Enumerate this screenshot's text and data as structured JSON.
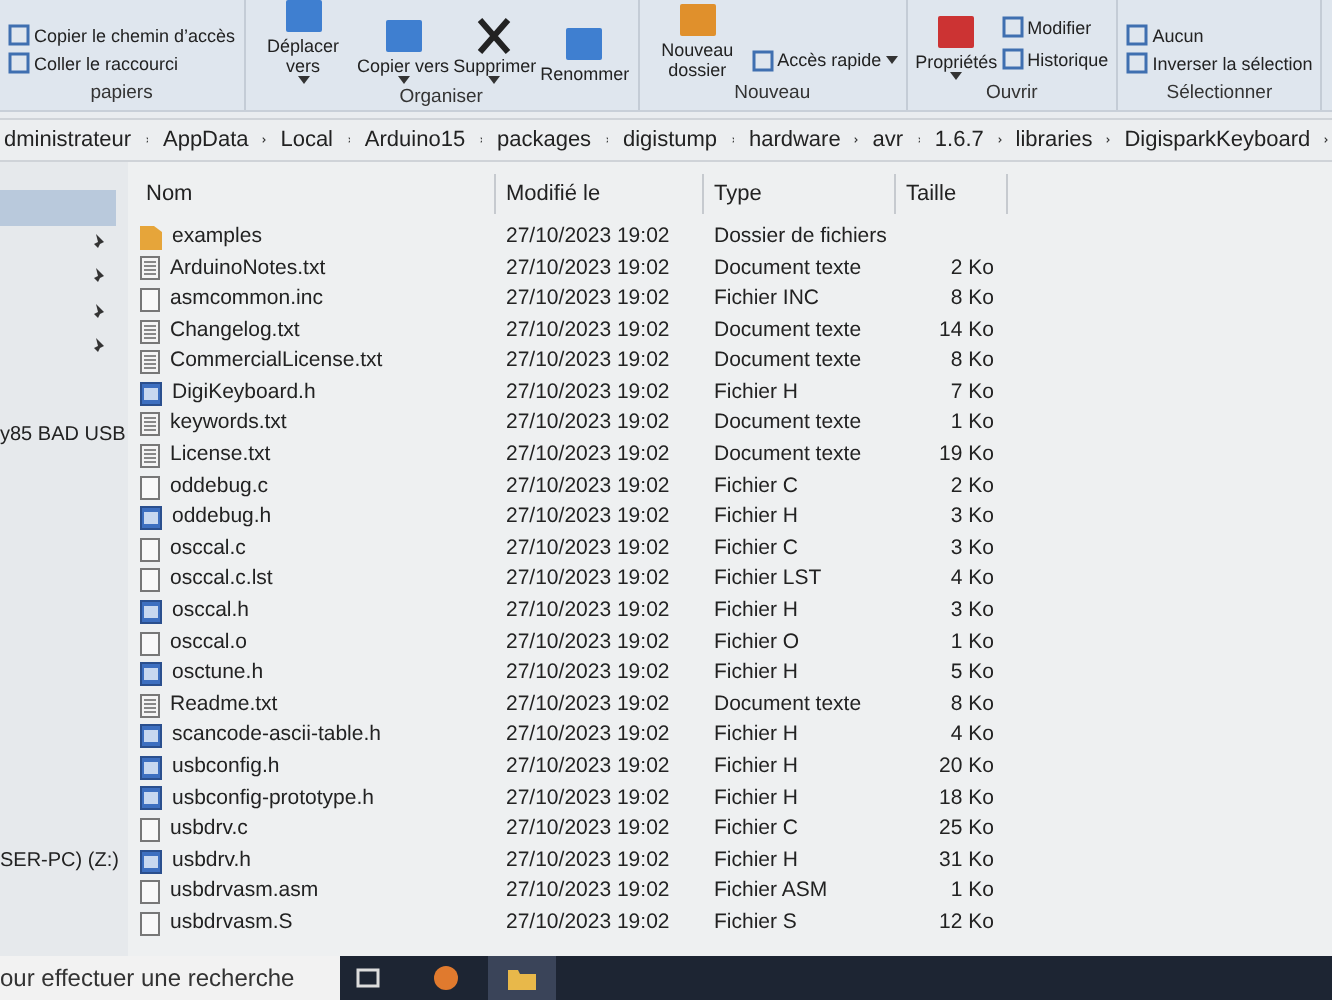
{
  "ribbon": {
    "groups": [
      {
        "label": "papiers",
        "items": [
          {
            "label": "Copier le chemin d’accès",
            "kind": "small"
          },
          {
            "label": "Coller le raccourci",
            "kind": "small"
          }
        ]
      },
      {
        "label": "Organiser",
        "items": [
          {
            "label": "Déplacer vers",
            "kind": "large",
            "dropdown": true
          },
          {
            "label": "Copier vers",
            "kind": "large",
            "dropdown": true
          },
          {
            "label": "Supprimer",
            "kind": "large",
            "dropdown": true
          },
          {
            "label": "Renommer",
            "kind": "large",
            "dropdown": false
          }
        ]
      },
      {
        "label": "Nouveau",
        "items": [
          {
            "label": "Nouveau dossier",
            "kind": "large",
            "dropdown": false
          },
          {
            "label": "Accès rapide",
            "kind": "small",
            "dropdown": true
          }
        ]
      },
      {
        "label": "Ouvrir",
        "items": [
          {
            "label": "Propriétés",
            "kind": "large",
            "dropdown": true
          },
          {
            "label": "Modifier",
            "kind": "small"
          },
          {
            "label": "Historique",
            "kind": "small"
          }
        ]
      },
      {
        "label": "Sélectionner",
        "items": [
          {
            "label": "Aucun",
            "kind": "small"
          },
          {
            "label": "Inverser la sélection",
            "kind": "small"
          }
        ]
      }
    ]
  },
  "breadcrumb": [
    "dministrateur",
    "AppData",
    "Local",
    "Arduino15",
    "packages",
    "digistump",
    "hardware",
    "avr",
    "1.6.7",
    "libraries",
    "DigisparkKeyboard"
  ],
  "nav": {
    "items": [
      {
        "selected": true,
        "pinned": false
      },
      {
        "selected": false,
        "pinned": true
      },
      {
        "selected": false,
        "pinned": true
      },
      {
        "selected": false,
        "pinned": true
      },
      {
        "selected": false,
        "pinned": true
      },
      {
        "label": "y85 BAD USB",
        "selected": false,
        "pinned": false
      },
      {
        "label": "SER-PC) (Z:)",
        "selected": false,
        "pinned": false
      }
    ]
  },
  "table": {
    "columns": [
      "Nom",
      "Modifié le",
      "Type",
      "Taille"
    ],
    "rows": [
      {
        "kind": "folder",
        "name": "examples",
        "modified": "27/10/2023 19:02",
        "type": "Dossier de fichiers"
      },
      {
        "kind": "text",
        "name": "ArduinoNotes.txt",
        "modified": "27/10/2023 19:02",
        "type": "Document texte",
        "size": "2 Ko"
      },
      {
        "kind": "plain",
        "name": "asmcommon.inc",
        "modified": "27/10/2023 19:02",
        "type": "Fichier INC",
        "size": "8 Ko"
      },
      {
        "kind": "text",
        "name": "Changelog.txt",
        "modified": "27/10/2023 19:02",
        "type": "Document texte",
        "size": "14 Ko"
      },
      {
        "kind": "text",
        "name": "CommercialLicense.txt",
        "modified": "27/10/2023 19:02",
        "type": "Document texte",
        "size": "8 Ko"
      },
      {
        "kind": "header",
        "name": "DigiKeyboard.h",
        "modified": "27/10/2023 19:02",
        "type": "Fichier H",
        "size": "7 Ko"
      },
      {
        "kind": "text",
        "name": "keywords.txt",
        "modified": "27/10/2023 19:02",
        "type": "Document texte",
        "size": "1 Ko"
      },
      {
        "kind": "text",
        "name": "License.txt",
        "modified": "27/10/2023 19:02",
        "type": "Document texte",
        "size": "19 Ko"
      },
      {
        "kind": "plain",
        "name": "oddebug.c",
        "modified": "27/10/2023 19:02",
        "type": "Fichier C",
        "size": "2 Ko"
      },
      {
        "kind": "header",
        "name": "oddebug.h",
        "modified": "27/10/2023 19:02",
        "type": "Fichier H",
        "size": "3 Ko"
      },
      {
        "kind": "plain",
        "name": "osccal.c",
        "modified": "27/10/2023 19:02",
        "type": "Fichier C",
        "size": "3 Ko"
      },
      {
        "kind": "plain",
        "name": "osccal.c.lst",
        "modified": "27/10/2023 19:02",
        "type": "Fichier LST",
        "size": "4 Ko"
      },
      {
        "kind": "header",
        "name": "osccal.h",
        "modified": "27/10/2023 19:02",
        "type": "Fichier H",
        "size": "3 Ko"
      },
      {
        "kind": "plain",
        "name": "osccal.o",
        "modified": "27/10/2023 19:02",
        "type": "Fichier O",
        "size": "1 Ko"
      },
      {
        "kind": "header",
        "name": "osctune.h",
        "modified": "27/10/2023 19:02",
        "type": "Fichier H",
        "size": "5 Ko"
      },
      {
        "kind": "text",
        "name": "Readme.txt",
        "modified": "27/10/2023 19:02",
        "type": "Document texte",
        "size": "8 Ko"
      },
      {
        "kind": "header",
        "name": "scancode-ascii-table.h",
        "modified": "27/10/2023 19:02",
        "type": "Fichier H",
        "size": "4 Ko"
      },
      {
        "kind": "header",
        "name": "usbconfig.h",
        "modified": "27/10/2023 19:02",
        "type": "Fichier H",
        "size": "20 Ko"
      },
      {
        "kind": "header",
        "name": "usbconfig-prototype.h",
        "modified": "27/10/2023 19:02",
        "type": "Fichier H",
        "size": "18 Ko"
      },
      {
        "kind": "plain",
        "name": "usbdrv.c",
        "modified": "27/10/2023 19:02",
        "type": "Fichier C",
        "size": "25 Ko"
      },
      {
        "kind": "header",
        "name": "usbdrv.h",
        "modified": "27/10/2023 19:02",
        "type": "Fichier H",
        "size": "31 Ko"
      },
      {
        "kind": "plain",
        "name": "usbdrvasm.asm",
        "modified": "27/10/2023 19:02",
        "type": "Fichier ASM",
        "size": "1 Ko"
      },
      {
        "kind": "plain",
        "name": "usbdrvasm.S",
        "modified": "27/10/2023 19:02",
        "type": "Fichier S",
        "size": "12 Ko"
      }
    ]
  },
  "search": {
    "placeholder": "our effectuer une recherche"
  }
}
